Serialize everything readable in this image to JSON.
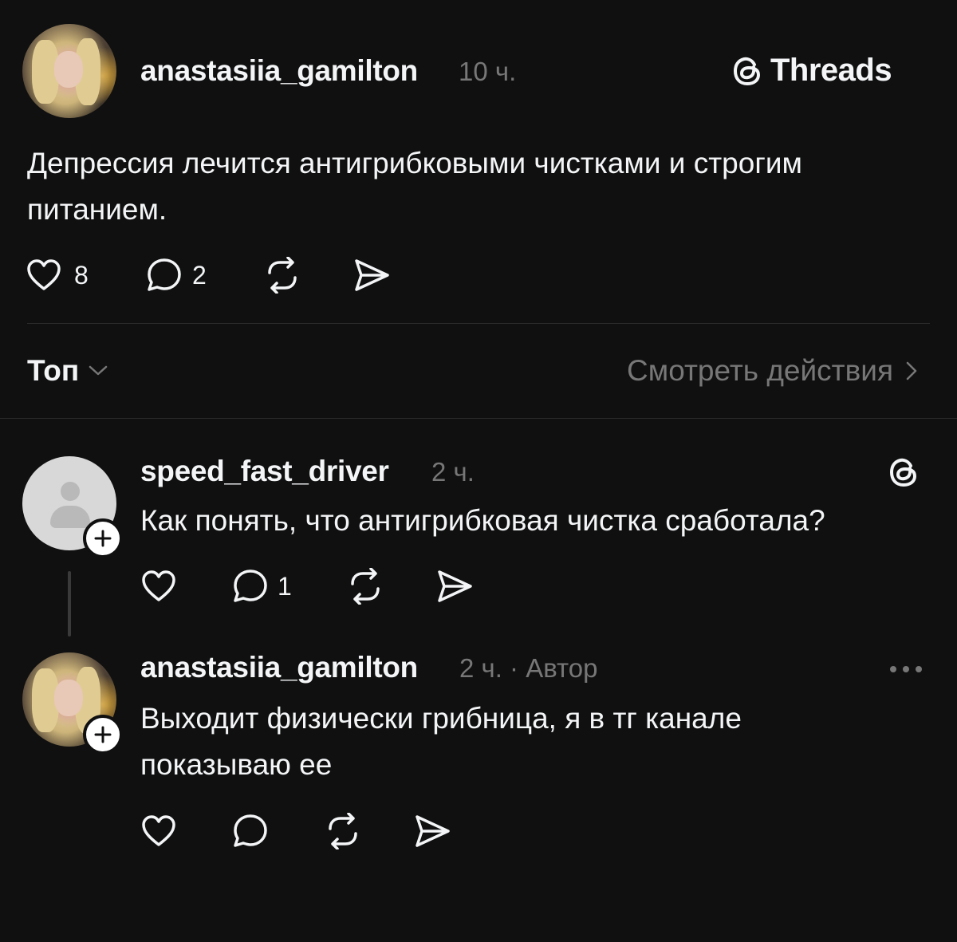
{
  "post": {
    "username": "anastasiia_gamilton",
    "time": "10 ч.",
    "brand": "Threads",
    "text_line1": "Депрессия лечится антигрибковыми чистками и строгим",
    "text_line2": "питанием.",
    "likes": "8",
    "replies": "2"
  },
  "filter": {
    "sort_label": "Топ",
    "view_activity": "Смотреть действия"
  },
  "comments": [
    {
      "username": "speed_fast_driver",
      "time": "2 ч.",
      "text": "Как понять, что антигрибковая чистка сработала?",
      "replies": "1"
    },
    {
      "username": "anastasiia_gamilton",
      "time": "2 ч. · Автор",
      "text_line1": "Выходит физически грибница, я в тг канале",
      "text_line2": "показываю ее"
    }
  ],
  "icons": {
    "like": "heart-icon",
    "reply": "comment-icon",
    "repost": "repost-icon",
    "share": "send-icon",
    "threads": "threads-logo-icon",
    "more": "more-icon",
    "chevron_down": "chevron-down-icon",
    "chevron_right": "chevron-right-icon",
    "follow": "plus-icon"
  },
  "colors": {
    "background": "#101010",
    "text": "#f3f5f7",
    "secondary": "#777777"
  }
}
